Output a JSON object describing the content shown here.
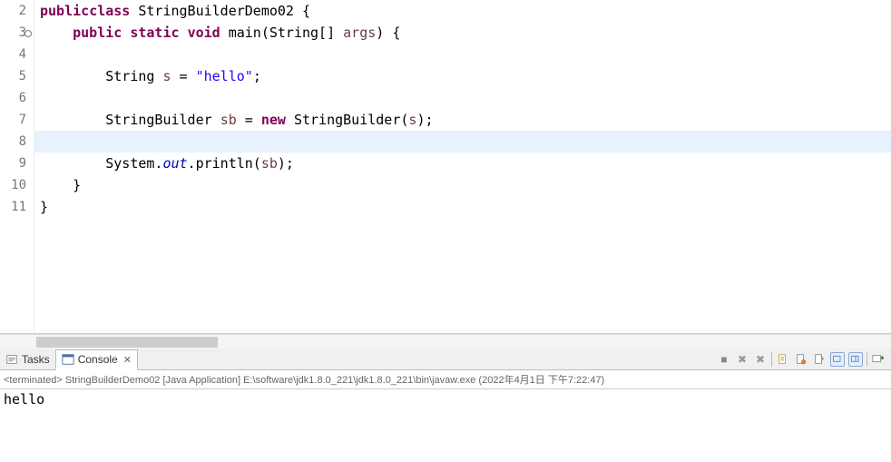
{
  "editor": {
    "lines": [
      {
        "n": "2",
        "tokens": [
          [
            "kw",
            "public"
          ],
          [
            "",
            ""
          ],
          [
            "kw",
            "class"
          ],
          [
            "",
            " StringBuilderDemo02 {"
          ]
        ]
      },
      {
        "n": "3",
        "circ": true,
        "tokens": [
          [
            "",
            "    "
          ],
          [
            "kw",
            "public"
          ],
          [
            "",
            " "
          ],
          [
            "kw",
            "static"
          ],
          [
            "",
            " "
          ],
          [
            "kw",
            "void"
          ],
          [
            "",
            " main(String[] "
          ],
          [
            "param",
            "args"
          ],
          [
            "",
            ") {"
          ]
        ]
      },
      {
        "n": "4",
        "tokens": []
      },
      {
        "n": "5",
        "tokens": [
          [
            "",
            "        String "
          ],
          [
            "lvar",
            "s"
          ],
          [
            "",
            " = "
          ],
          [
            "str",
            "\"hello\""
          ],
          [
            "",
            ";"
          ]
        ]
      },
      {
        "n": "6",
        "tokens": []
      },
      {
        "n": "7",
        "tokens": [
          [
            "",
            "        StringBuilder "
          ],
          [
            "lvar",
            "sb"
          ],
          [
            "",
            " = "
          ],
          [
            "kw",
            "new"
          ],
          [
            "",
            " StringBuilder("
          ],
          [
            "lvar",
            "s"
          ],
          [
            "",
            ");"
          ]
        ]
      },
      {
        "n": "8",
        "hl": true,
        "tokens": []
      },
      {
        "n": "9",
        "tokens": [
          [
            "",
            "        System."
          ],
          [
            "sfield",
            "out"
          ],
          [
            "",
            ".println("
          ],
          [
            "lvar",
            "sb"
          ],
          [
            "",
            ");"
          ]
        ]
      },
      {
        "n": "10",
        "tokens": [
          [
            "",
            "    }"
          ]
        ]
      },
      {
        "n": "11",
        "tokens": [
          [
            "",
            "}"
          ]
        ]
      }
    ]
  },
  "tabs": {
    "tasks_label": "Tasks",
    "console_label": "Console"
  },
  "console": {
    "status": "<terminated> StringBuilderDemo02 [Java Application] E:\\software\\jdk1.8.0_221\\jdk1.8.0_221\\bin\\javaw.exe (2022年4月1日 下午7:22:47)",
    "output": "hello"
  },
  "icons": {
    "terminate": "■",
    "remove_x": "✖",
    "remove_xx": "✖",
    "scroll_lock": "🔒",
    "clear": "📄",
    "pin": "📌",
    "display1": "▭",
    "display2": "▭",
    "new_console": "➕"
  }
}
